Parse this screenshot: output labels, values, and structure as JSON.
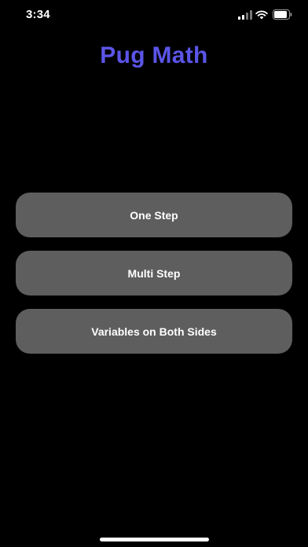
{
  "status_bar": {
    "time": "3:34",
    "signal_icon": "cellular-signal-icon",
    "wifi_icon": "wifi-icon",
    "battery_icon": "battery-icon"
  },
  "app": {
    "title": "Pug Math",
    "title_color": "#5b55e8"
  },
  "menu": {
    "items": [
      {
        "label": "One Step"
      },
      {
        "label": "Multi Step"
      },
      {
        "label": "Variables on Both Sides"
      }
    ],
    "button_color": "#5e5e5e"
  }
}
